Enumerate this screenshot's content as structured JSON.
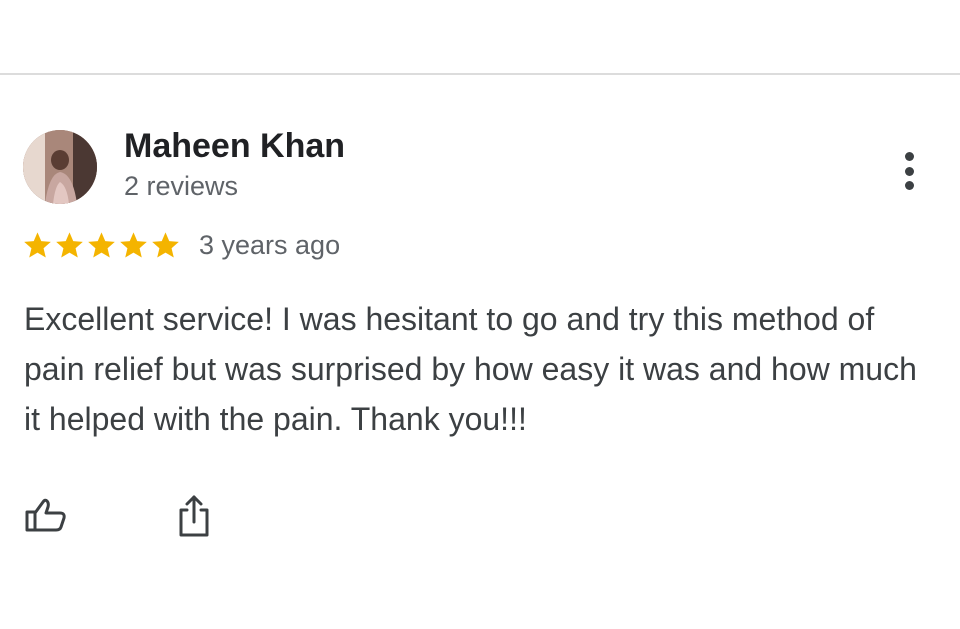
{
  "review": {
    "author_name": "Maheen Khan",
    "review_count": "2 reviews",
    "rating": 5,
    "max_rating": 5,
    "time": "3 years ago",
    "text": "Excellent service! I was hesitant to go and try this method of pain relief but was surprised by how easy it was and how much it helped with the pain. Thank you!!!"
  },
  "icons": {
    "more": "more-vertical-icon",
    "star": "star-icon",
    "like": "thumbs-up-icon",
    "share": "share-icon"
  },
  "colors": {
    "star": "#F4B400",
    "name": "#202124",
    "secondary_text": "#5F6368",
    "body_text": "#3C4043",
    "divider": "#DCDCDC"
  }
}
